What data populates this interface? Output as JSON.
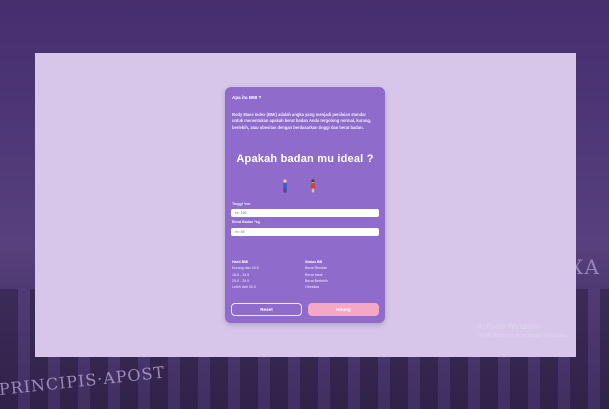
{
  "background": {
    "inscription_left": "PRINCIPIS·APOST",
    "inscription_right": "XA"
  },
  "card": {
    "question_title": "Apa itu BMI ?",
    "description": "Body Mass Index (BMI) adalah angka yang menjadi penilaian standar untuk menentukan apakah berat badan Anda tergolong normal, kurang, berlebih, atau obesitas dengan berdasarkan tinggi dan berat badan.",
    "headline": "Apakah badan mu ideal ?",
    "figures": {
      "male_icon": "male-figure-icon",
      "female_icon": "female-figure-icon",
      "male_color": "#3a5cc4",
      "female_color": "#d8402e"
    },
    "height_field": {
      "label": "Tinggi *cm",
      "placeholder": "ex: 169"
    },
    "weight_field": {
      "label": "Berat Badan *kg",
      "placeholder": "ex: 65"
    },
    "bmi_table": {
      "header_bmi": "Hasil BMI",
      "header_status": "Status BB",
      "rows": [
        {
          "range": "Kurang dari 18.5",
          "status": "Berat Rendah"
        },
        {
          "range": "18.5 - 24.9",
          "status": "Berat Ideal"
        },
        {
          "range": "25.0 - 29.9",
          "status": "Berat Berlebih"
        },
        {
          "range": "Lebih dari 30.0",
          "status": "Obesitas"
        }
      ]
    },
    "buttons": {
      "reset": "Reset",
      "hitung": "Hitung"
    }
  },
  "watermark": {
    "title": "Activate Windows",
    "subtitle": "Go to Settings to activate Windows."
  },
  "colors": {
    "overlay": "#d7c6ea",
    "card": "#8f6bcb",
    "hitung_button": "#f5a7c6"
  }
}
